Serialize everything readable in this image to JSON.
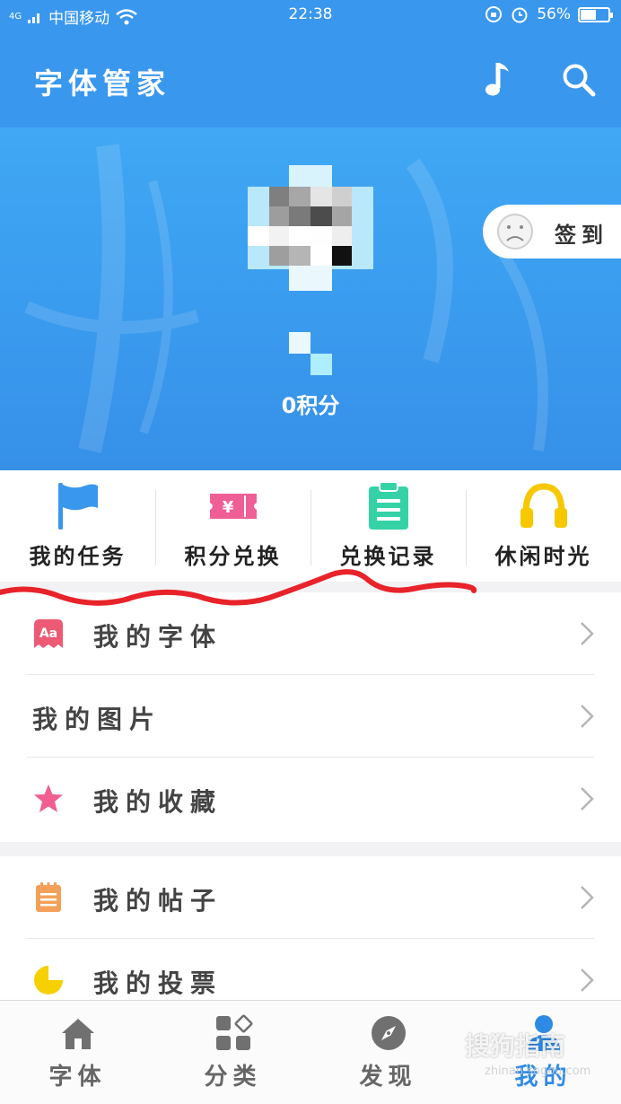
{
  "status_bar": {
    "network": "4G",
    "carrier": "中国移动",
    "time": "22:38",
    "battery": "56%",
    "battery_level": 0.56
  },
  "header": {
    "title": "字体管家",
    "music_icon": "music-note-icon",
    "search_icon": "search-icon"
  },
  "profile": {
    "points_text": "0积分",
    "checkin_label": "签到"
  },
  "quick_actions": [
    {
      "label": "我的任务",
      "icon": "flag-icon",
      "color": "#3a97ee"
    },
    {
      "label": "积分兑换",
      "icon": "ticket-icon",
      "color": "#ef5f95"
    },
    {
      "label": "兑换记录",
      "icon": "clipboard-icon",
      "color": "#35d2a7"
    },
    {
      "label": "休闲时光",
      "icon": "headphones-icon",
      "color": "#f7c800"
    }
  ],
  "menu_group_1": [
    {
      "label": "我的字体",
      "icon": "font-aa-icon"
    },
    {
      "label": "我的图片",
      "icon": ""
    },
    {
      "label": "我的收藏",
      "icon": "star-icon"
    }
  ],
  "menu_group_2": [
    {
      "label": "我的帖子",
      "icon": "notepad-icon"
    },
    {
      "label": "我的投票",
      "icon": "pie-chart-icon"
    }
  ],
  "bottom_nav": [
    {
      "label": "字体",
      "icon": "home-icon",
      "active": false
    },
    {
      "label": "分类",
      "icon": "category-grid-icon",
      "active": false
    },
    {
      "label": "发现",
      "icon": "compass-icon",
      "active": false
    },
    {
      "label": "我的",
      "icon": "profile-icon",
      "active": true
    }
  ],
  "watermark": {
    "text": "搜狗指南",
    "sub": "zhinan.sogou.com"
  },
  "colors": {
    "primary": "#3a97ee",
    "pink": "#ef5f95",
    "teal": "#35d2a7",
    "yellow": "#f7c800",
    "orange": "#f3a15a",
    "annotation_red": "#e8232a"
  }
}
